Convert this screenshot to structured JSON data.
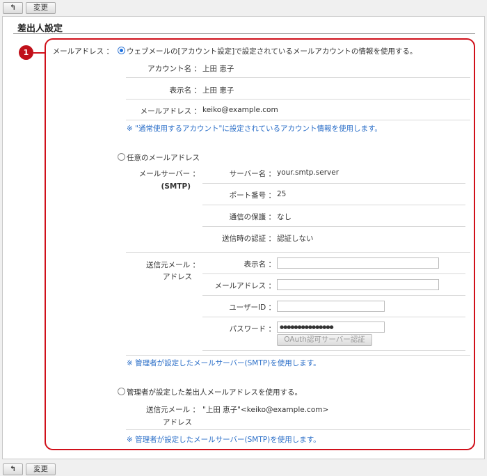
{
  "toolbar": {
    "back_icon": "back-arrow-icon",
    "change_label": "変更"
  },
  "section_title": "差出人設定",
  "badge": "1",
  "email_label": "メールアドレス ：",
  "option1": {
    "label": "ウェブメールの[アカウント設定]で設定されているメールアカウントの情報を使用する。",
    "selected": true,
    "rows": [
      {
        "label": "アカウント名 ：",
        "value": "上田 恵子"
      },
      {
        "label": "表示名 ：",
        "value": "上田 恵子"
      },
      {
        "label": "メールアドレス ：",
        "value": "keiko@example.com"
      }
    ],
    "note": "※ \"通常使用するアカウント\"に設定されているアカウント情報を使用します。"
  },
  "option2": {
    "label": "任意のメールアドレス",
    "selected": false,
    "server_label": "メールサーバー ：",
    "server_label2": "(SMTP)",
    "server_rows": [
      {
        "label": "サーバー名 ：",
        "value": "your.smtp.server"
      },
      {
        "label": "ポート番号 ：",
        "value": "25"
      },
      {
        "label": "通信の保護 ：",
        "value": "なし"
      },
      {
        "label": "送信時の認証 ：",
        "value": "認証しない"
      }
    ],
    "sender_label": "送信元メール ：",
    "sender_label2": "アドレス",
    "fields": {
      "display_name": {
        "label": "表示名 ：",
        "value": ""
      },
      "email": {
        "label": "メールアドレス ：",
        "value": ""
      },
      "user_id": {
        "label": "ユーザーID ：",
        "value": ""
      },
      "password": {
        "label": "パスワード ：",
        "value": "●●●●●●●●●●●●●●●"
      }
    },
    "oauth_button": "OAuth認可サーバー認証",
    "note": "※ 管理者が設定したメールサーバー(SMTP)を使用します。"
  },
  "option3": {
    "label": "管理者が設定した差出人メールアドレスを使用する。",
    "selected": false,
    "sender_label": "送信元メール ：",
    "sender_label2": "アドレス",
    "value": "\"上田 恵子\"<keiko@example.com>",
    "note": "※ 管理者が設定したメールサーバー(SMTP)を使用します。"
  }
}
